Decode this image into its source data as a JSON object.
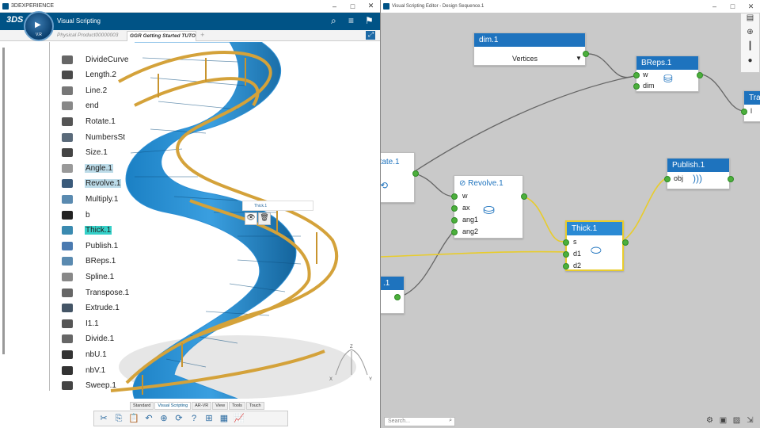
{
  "left_window": {
    "title": "3DEXPERIENCE",
    "app_name": "Visual Scripting",
    "brand": "3DS",
    "compass_version": "V.R",
    "tabs": [
      "Physical Product00000003",
      "GGR Getting Started TUTO"
    ],
    "tree_items": [
      {
        "label": "DivideCurve",
        "style": "none",
        "icon": "curve-icon"
      },
      {
        "label": "Length.2",
        "style": "none",
        "icon": "length-icon"
      },
      {
        "label": "Line.2",
        "style": "none",
        "icon": "line-icon"
      },
      {
        "label": "end",
        "style": "none",
        "icon": "end-icon"
      },
      {
        "label": "Rotate.1",
        "style": "none",
        "icon": "rotate-icon"
      },
      {
        "label": "NumbersSt",
        "style": "none",
        "icon": "numbers-icon"
      },
      {
        "label": "Size.1",
        "style": "none",
        "icon": "size-icon"
      },
      {
        "label": "Angle.1",
        "style": "highlight",
        "icon": "angle-icon"
      },
      {
        "label": "Revolve.1",
        "style": "highlight",
        "icon": "revolve-icon"
      },
      {
        "label": "Multiply.1",
        "style": "none",
        "icon": "multiply-icon"
      },
      {
        "label": "b",
        "style": "none",
        "icon": "b-icon"
      },
      {
        "label": "Thick.1",
        "style": "selected",
        "icon": "thick-icon"
      },
      {
        "label": "Publish.1",
        "style": "none",
        "icon": "publish-icon"
      },
      {
        "label": "BReps.1",
        "style": "none",
        "icon": "breps-icon"
      },
      {
        "label": "Spline.1",
        "style": "none",
        "icon": "spline-icon"
      },
      {
        "label": "Transpose.1",
        "style": "none",
        "icon": "transpose-icon"
      },
      {
        "label": "Extrude.1",
        "style": "none",
        "icon": "extrude-icon"
      },
      {
        "label": "I1.1",
        "style": "none",
        "icon": "i1-icon"
      },
      {
        "label": "Divide.1",
        "style": "none",
        "icon": "divide-icon"
      },
      {
        "label": "nbU.1",
        "style": "none",
        "icon": "nbu-icon"
      },
      {
        "label": "nbV.1",
        "style": "none",
        "icon": "nbv-icon"
      },
      {
        "label": "Sweep.1",
        "style": "none",
        "icon": "sweep-icon"
      }
    ],
    "context_label": "Thick.1",
    "axes": {
      "z": "Z",
      "x": "X",
      "y": "Y"
    },
    "bottom_tabs": [
      "Standard",
      "Visual Scripting",
      "AR-VR",
      "View",
      "Tools",
      "Touch"
    ],
    "active_bottom_tab": "Visual Scripting"
  },
  "right_window": {
    "title": "Visual Scripting Editor - Design Sequence.1",
    "search_placeholder": "Search...",
    "nodes": {
      "dim": {
        "title": "dim.1",
        "dropdown": "Vertices"
      },
      "breps": {
        "title": "BReps.1",
        "inputs": [
          "w",
          "dim"
        ]
      },
      "transpose": {
        "title": "Tra",
        "inputs": [
          "l"
        ]
      },
      "rotate": {
        "title": "otate.1"
      },
      "revolve": {
        "title": "Revolve.1",
        "inputs": [
          "w",
          "ax",
          "ang1",
          "ang2"
        ]
      },
      "publish": {
        "title": "Publish.1",
        "inputs": [
          "obj"
        ]
      },
      "thick": {
        "title": "Thick.1",
        "inputs": [
          "s",
          "d1",
          "d2"
        ]
      },
      "partial": {
        "title": ".1"
      }
    }
  },
  "colors": {
    "brand_blue": "#005386",
    "node_header": "#1e73be",
    "thick_header": "#2a8ad4",
    "port_green": "#4caf3c",
    "link_yellow": "#e8cc2c",
    "selected": "#35d0c8"
  }
}
